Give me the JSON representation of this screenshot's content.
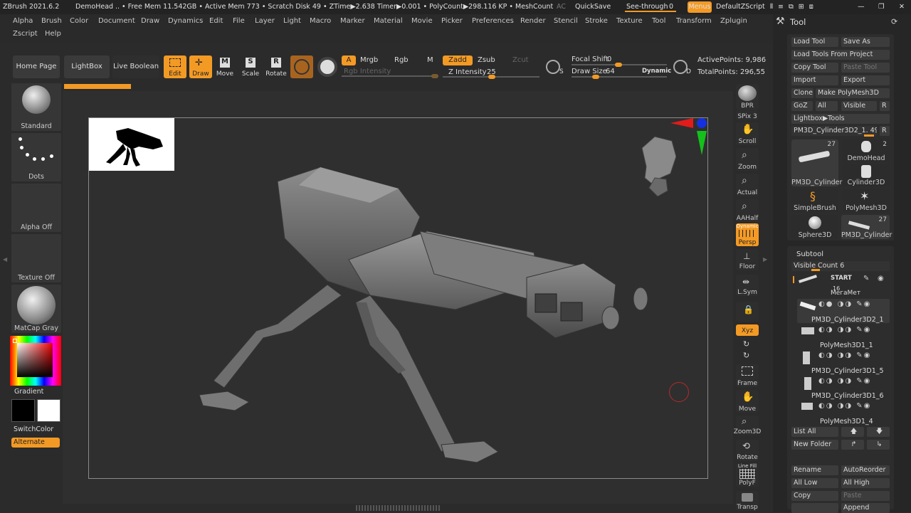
{
  "title": {
    "app": "ZBrush 2021.6.2",
    "doc": "DemoHead",
    "status": ".. • Free Mem 11.542GB • Active Mem 773 • Scratch Disk 49 • ZTime▶2.638 Timer▶0.001 • PolyCount▶298.116 KP • MeshCount▶2?",
    "ac": "AC",
    "quicksave": "QuickSave",
    "seethrough": "See-through",
    "seethrough_val": "0",
    "menus": "Menus",
    "script": "DefaultZScript"
  },
  "menu": {
    "row1": [
      "Alpha",
      "Brush",
      "Color",
      "Document",
      "Draw",
      "Dynamics",
      "Edit",
      "File",
      "Layer",
      "Light",
      "Macro",
      "Marker",
      "Material",
      "Movie",
      "Picker",
      "Preferences",
      "Render",
      "Stencil",
      "Stroke",
      "Texture",
      "Tool",
      "Transform",
      "Zplugin"
    ],
    "row2": [
      "Zscript",
      "Help"
    ]
  },
  "toolbar": {
    "home": "Home Page",
    "lightbox": "LightBox",
    "liveboolean": "Live Boolean",
    "edit": "Edit",
    "draw": "Draw",
    "move": "Move",
    "scale": "Scale",
    "rotate": "Rotate",
    "a": "A",
    "mrgb": "Mrgb",
    "rgb": "Rgb",
    "m": "M",
    "zadd": "Zadd",
    "zsub": "Zsub",
    "zcut": "Zcut",
    "rgb_intensity": "Rgb Intensity",
    "z_intensity": "Z Intensity",
    "z_intensity_val": "25",
    "focal": "Focal Shift",
    "focal_val": "0",
    "drawsize": "Draw Size",
    "drawsize_val": "64",
    "dynamic": "Dynamic",
    "activepoints": "ActivePoints: 9,986",
    "totalpoints": "TotalPoints: 296,55",
    "icon_s": "S",
    "icon_d": "D"
  },
  "left": {
    "standard": "Standard",
    "dots": "Dots",
    "alphaoff": "Alpha Off",
    "textureoff": "Texture Off",
    "matcap": "MatCap Gray",
    "gradient": "Gradient",
    "switchcolor": "SwitchColor",
    "alternate": "Alternate"
  },
  "righttools": {
    "bpr": "BPR",
    "spix": "SPix 3",
    "scroll": "Scroll",
    "zoom": "Zoom",
    "actual": "Actual",
    "aahalf": "AAHalf",
    "persp": "Persp",
    "dynamic": "Dynamic",
    "floor": "Floor",
    "lsym": "L.Sym",
    "xyz": "Xyz",
    "frame": "Frame",
    "move": "Move",
    "zoom3d": "Zoom3D",
    "rotate": "Rotate",
    "linefill": "Line Fill",
    "polyf": "PolyF",
    "transp": "Transp"
  },
  "panel": {
    "title": "Tool",
    "loadtool": "Load Tool",
    "saveas": "Save As",
    "loadproject": "Load Tools From Project",
    "copytool": "Copy Tool",
    "pastetool": "Paste Tool",
    "import": "Import",
    "export": "Export",
    "clone": "Clone",
    "makepoly": "Make PolyMesh3D",
    "goz": "GoZ",
    "all": "All",
    "visible": "Visible",
    "r": "R",
    "lightboxtools": "Lightbox▶Tools",
    "currenttool": "PM3D_Cylinder3D2_1. 49",
    "tools": [
      {
        "name": "PM3D_Cylinder",
        "count": "27"
      },
      {
        "name": "DemoHead",
        "count": "2"
      },
      {
        "name": "Cylinder3D",
        "count": ""
      },
      {
        "name": "SimpleBrush",
        "count": ""
      },
      {
        "name": "PolyMesh3D",
        "count": ""
      },
      {
        "name": "Sphere3D",
        "count": ""
      },
      {
        "name": "PM3D_Cylinder",
        "count": "27"
      }
    ],
    "subtool": "Subtool",
    "visiblecount": "Visible Count 6",
    "subtools": [
      {
        "name": "START",
        "sub": "МегаМет"
      },
      {
        "name": "PM3D_Cylinder3D2_1",
        "sub": "16"
      },
      {
        "name": "PolyMesh3D1_1",
        "sub": ""
      },
      {
        "name": "PM3D_Cylinder3D1_5",
        "sub": ""
      },
      {
        "name": "PM3D_Cylinder3D1_6",
        "sub": ""
      },
      {
        "name": "PolyMesh3D1_4",
        "sub": ""
      }
    ],
    "listall": "List All",
    "newfolder": "New Folder",
    "rename": "Rename",
    "autoreorder": "AutoReorder",
    "alllow": "All Low",
    "allhigh": "All High",
    "copy": "Copy",
    "paste": "Paste",
    "append": "Append"
  },
  "colors": {
    "accent": "#f39a25",
    "bg": "#2b2b2b",
    "canvas": "#2f2f2f"
  }
}
